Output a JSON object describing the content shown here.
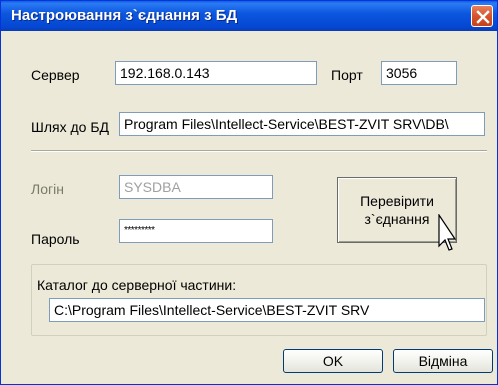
{
  "window": {
    "title": "Настроювання з`єднання з БД"
  },
  "icons": {
    "close": "close-icon",
    "cursor": "mouse-pointer-icon"
  },
  "server": {
    "label": "Сервер",
    "value": "192.168.0.143"
  },
  "port": {
    "label": "Порт",
    "value": "3056"
  },
  "db_path": {
    "label": "Шлях до БД",
    "value": "Program Files\\Intellect-Service\\BEST-ZVIT SRV\\DB\\"
  },
  "login": {
    "label": "Логін",
    "value": "SYSDBA"
  },
  "password": {
    "label": "Пароль",
    "value": "*********"
  },
  "check_button": {
    "line1": "Перевірити",
    "line2": "з`єднання"
  },
  "server_catalog": {
    "label": "Каталог до серверної частини:",
    "value": "C:\\Program Files\\Intellect-Service\\BEST-ZVIT SRV"
  },
  "buttons": {
    "ok": "OK",
    "cancel": "Відміна"
  }
}
